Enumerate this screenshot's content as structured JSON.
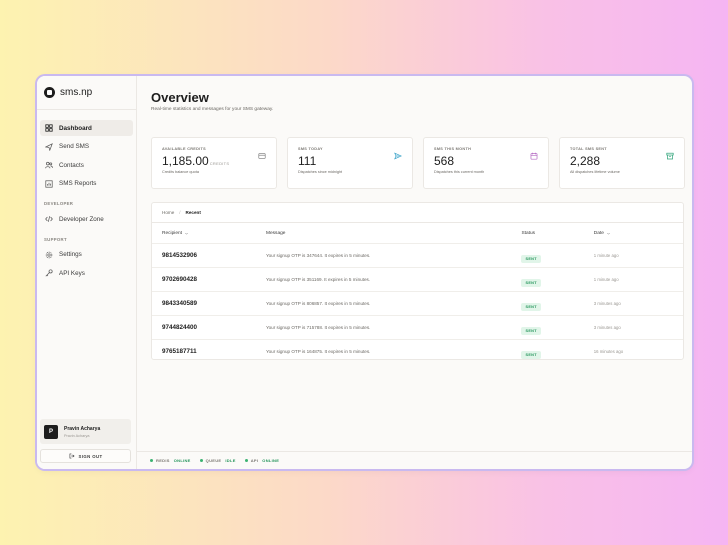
{
  "brand": {
    "name": "sms.np"
  },
  "nav": {
    "dashboard": "Dashboard",
    "send_sms": "Send SMS",
    "contacts": "Contacts",
    "sms_reports": "SMS Reports",
    "developer_section": "DEVELOPER",
    "developer_zone": "Developer Zone",
    "support_section": "SUPPORT",
    "settings": "Settings",
    "api_keys": "API Keys"
  },
  "user": {
    "initial": "P",
    "name": "Pravin Acharya",
    "handle": "Pravin Acharya"
  },
  "signout_label": "SIGN OUT",
  "page": {
    "title": "Overview",
    "subtitle": "Real-time statistics and messages for your SMS gateway."
  },
  "cards": [
    {
      "label": "AVAILABLE CREDITS",
      "value": "1,185.00",
      "unit": "CREDITS",
      "desc": "Credits balance quota",
      "icon": "wallet-icon"
    },
    {
      "label": "SMS TODAY",
      "value": "111",
      "unit": "",
      "desc": "Dispatches since midnight",
      "icon": "send-icon"
    },
    {
      "label": "SMS THIS MONTH",
      "value": "568",
      "unit": "",
      "desc": "Dispatches this current month",
      "icon": "calendar-icon"
    },
    {
      "label": "TOTAL SMS SENT",
      "value": "2,288",
      "unit": "",
      "desc": "All dispatches lifetime volume",
      "icon": "archive-icon"
    }
  ],
  "breadcrumb": {
    "home": "Home",
    "current": "Recent"
  },
  "table": {
    "headers": {
      "recipient": "Recipient",
      "message": "Message",
      "status": "Status",
      "date": "Date"
    },
    "rows": [
      {
        "recipient": "9814532906",
        "message": "Your signup OTP is 347644. It expires in 5 minutes.",
        "status": "SENT",
        "date": "1 minute ago"
      },
      {
        "recipient": "9702690428",
        "message": "Your signup OTP is 351169. It expires in 5 minutes.",
        "status": "SENT",
        "date": "1 minute ago"
      },
      {
        "recipient": "9843340589",
        "message": "Your signup OTP is 806857. It expires in 5 minutes.",
        "status": "SENT",
        "date": "3 minutes ago"
      },
      {
        "recipient": "9744824400",
        "message": "Your signup OTP is 715788. It expires in 5 minutes.",
        "status": "SENT",
        "date": "3 minutes ago"
      },
      {
        "recipient": "9765187711",
        "message": "Your signup OTP is 164875. It expires in 5 minutes.",
        "status": "SENT",
        "date": "16 minutes ago"
      }
    ]
  },
  "status_bar": [
    {
      "name": "REDIS",
      "value": "ONLINE"
    },
    {
      "name": "QUEUE",
      "value": "IDLE"
    },
    {
      "name": "API",
      "value": "ONLINE"
    }
  ],
  "colors": {
    "accent": "#1d1d1d",
    "success": "#23945a",
    "success_bg": "#e1f5e9",
    "border": "#c9b9f0"
  }
}
